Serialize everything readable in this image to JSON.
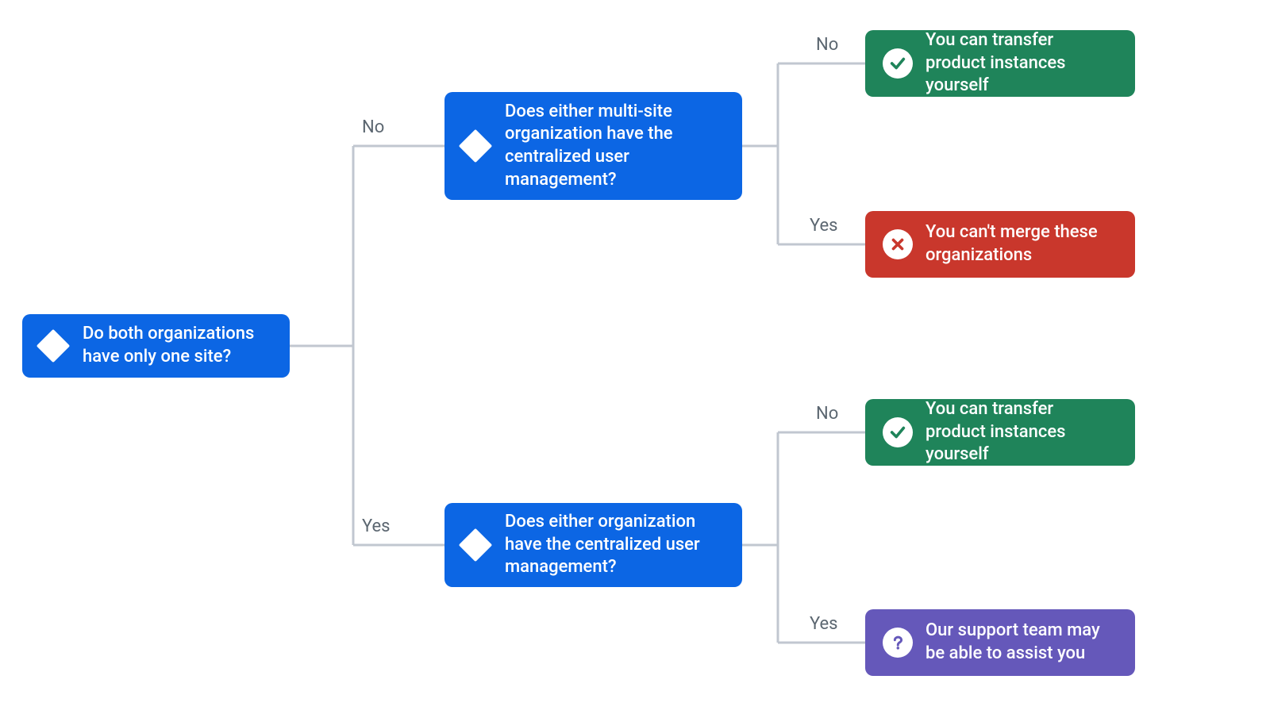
{
  "colors": {
    "blue": "#0c66e4",
    "green": "#1f845a",
    "red": "#c9372c",
    "purple": "#6558ba",
    "line": "#c1c7d0",
    "labelText": "#5b6670"
  },
  "labels": {
    "yes": "Yes",
    "no": "No"
  },
  "nodes": {
    "root": {
      "text": "Do both organizations have only one site?"
    },
    "q_no": {
      "text": "Does either multi-site organization have the centralized user management?"
    },
    "q_yes": {
      "text": "Does either organization have the centralized user management?"
    },
    "out_no_no": {
      "text": "You can transfer product instances yourself",
      "icon": "check"
    },
    "out_no_yes": {
      "text": "You can't merge these organizations",
      "icon": "cross"
    },
    "out_yes_no": {
      "text": "You can transfer product instances yourself",
      "icon": "check"
    },
    "out_yes_yes": {
      "text": "Our support team may be able to assist you",
      "icon": "question"
    }
  }
}
